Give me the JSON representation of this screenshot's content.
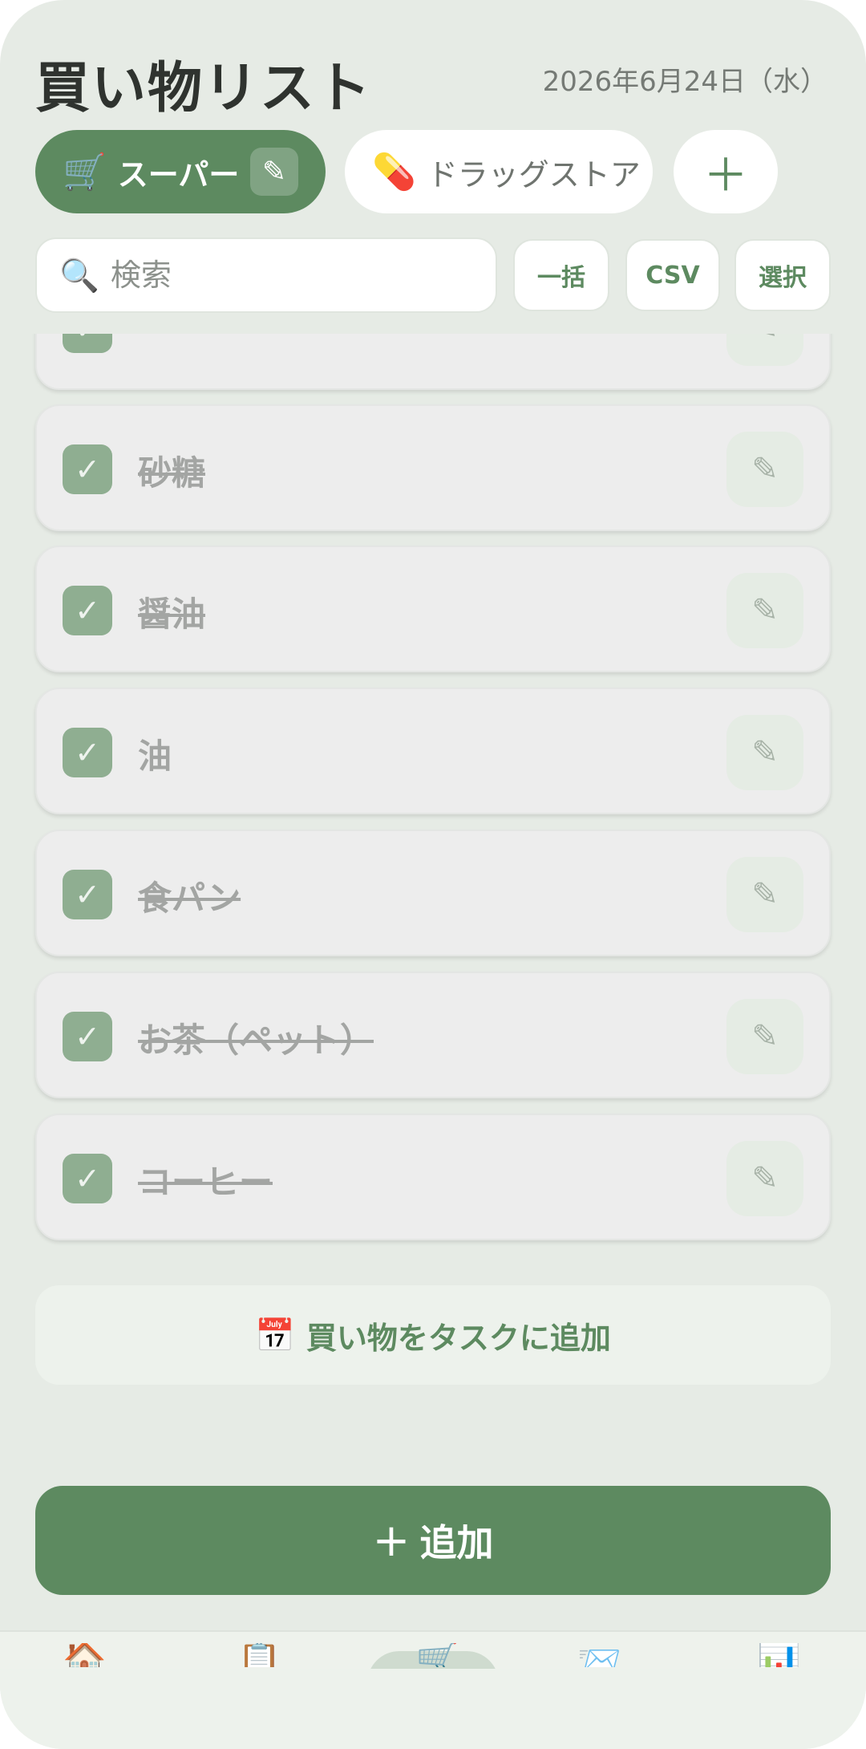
{
  "header": {
    "title": "買い物リスト",
    "date": "2026年6月24日（水）"
  },
  "tabs": [
    {
      "icon": "🛒",
      "label": "スーパー",
      "active": true
    },
    {
      "icon": "💊",
      "label": "ドラッグストア",
      "active": false
    }
  ],
  "tab_add_label": "＋",
  "tab_edit_icon": "✎",
  "search": {
    "placeholder": "検索",
    "icon": "🔍"
  },
  "toolbar": {
    "bulk": "一括",
    "csv": "CSV",
    "select": "選択"
  },
  "items": [
    {
      "label": "砂糖",
      "checked": true
    },
    {
      "label": "醤油",
      "checked": true
    },
    {
      "label": "油",
      "checked": true
    },
    {
      "label": "食パン",
      "checked": true
    },
    {
      "label": "お茶（ペット）",
      "checked": true
    },
    {
      "label": "コーヒー",
      "checked": true
    }
  ],
  "check_glyph": "✓",
  "edit_glyph": "✎",
  "task_button": {
    "icon": "📅",
    "label": "買い物をタスクに追加"
  },
  "add_button": {
    "plus": "+",
    "label": "追加"
  },
  "nav_icons": [
    "🏠",
    "📋",
    "🛒",
    "📨",
    "📊"
  ],
  "colors": {
    "accent": "#5d8a60",
    "background": "#e6ebe5"
  }
}
